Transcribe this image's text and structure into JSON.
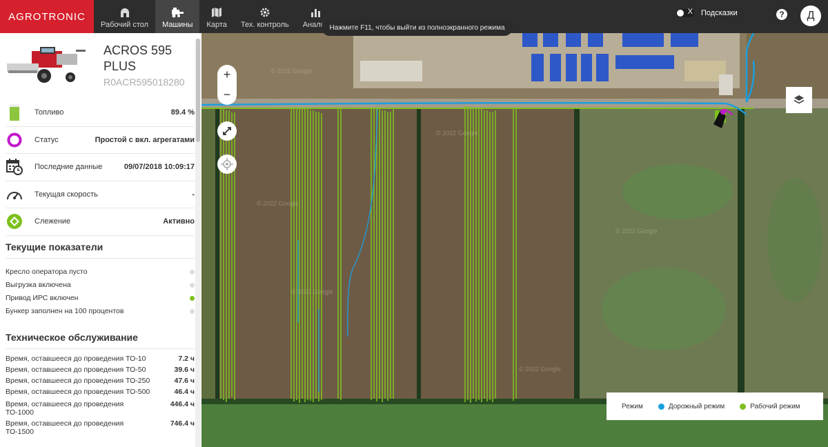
{
  "brand": "AGROTRONIC",
  "nav": [
    {
      "label": "Рабочий стол",
      "icon": "dashboard-icon"
    },
    {
      "label": "Машины",
      "icon": "harvester-icon",
      "active": true
    },
    {
      "label": "Карта",
      "icon": "map-icon"
    },
    {
      "label": "Тех. контроль",
      "icon": "gear-icon"
    },
    {
      "label": "Анализ",
      "icon": "bar-chart-icon"
    }
  ],
  "toast": "Нажмите F11, чтобы выйти из полноэкранного режима",
  "hints": {
    "label": "Подсказки",
    "toggle_x": "X"
  },
  "help_label": "?",
  "avatar_letter": "Д",
  "machine": {
    "name": "ACROS 595 PLUS",
    "serial": "R0ACR595018280"
  },
  "info": [
    {
      "label": "Топливо",
      "value": "89.4 %",
      "icon": "fuel-icon"
    },
    {
      "label": "Статус",
      "value": "Простой с вкл. агрегатами",
      "icon": "status-ring-icon"
    },
    {
      "label": "Последние данные",
      "value": "09/07/2018 10:09:17",
      "icon": "calendar-clock-icon"
    },
    {
      "label": "Текущая скорость",
      "value": "-",
      "icon": "speedometer-icon"
    },
    {
      "label": "Слежение",
      "value": "Активно",
      "icon": "tracking-icon"
    }
  ],
  "indicators_title": "Текущие показатели",
  "indicators": [
    {
      "label": "Кресло оператора пусто",
      "on": false
    },
    {
      "label": "Выгрузка включена",
      "on": false
    },
    {
      "label": "Привод ИРС включен",
      "on": true
    },
    {
      "label": "Бункер заполнен на 100 процентов",
      "on": false
    }
  ],
  "maintenance_title": "Техническое обслуживание",
  "maintenance": [
    {
      "label": "Время, оставшееся до проведения ТО-10",
      "value": "7.2 ч"
    },
    {
      "label": "Время, оставшееся до проведения ТО-50",
      "value": "39.6 ч"
    },
    {
      "label": "Время, оставшееся до проведения ТО-250",
      "value": "47.6 ч"
    },
    {
      "label": "Время, оставшееся до проведения ТО-500",
      "value": "46.4 ч"
    },
    {
      "label": "Время, оставшееся до проведения ТО-1000",
      "value": "446.4 ч"
    },
    {
      "label": "Время, оставшееся до проведения ТО-1500",
      "value": "746.4 ч"
    }
  ],
  "map": {
    "zoom_in": "+",
    "zoom_out": "−",
    "legend": {
      "title": "Режим",
      "road": "Дорожный режим",
      "work": "Рабочий режим",
      "road_color": "#1a9fe0",
      "work_color": "#7dc01e"
    },
    "watermark": "© 2022 Google"
  },
  "colors": {
    "brand": "#d6202d",
    "topbar": "#2d2d2d",
    "track_work": "#7dc01e",
    "track_road": "#1a9fe0"
  }
}
